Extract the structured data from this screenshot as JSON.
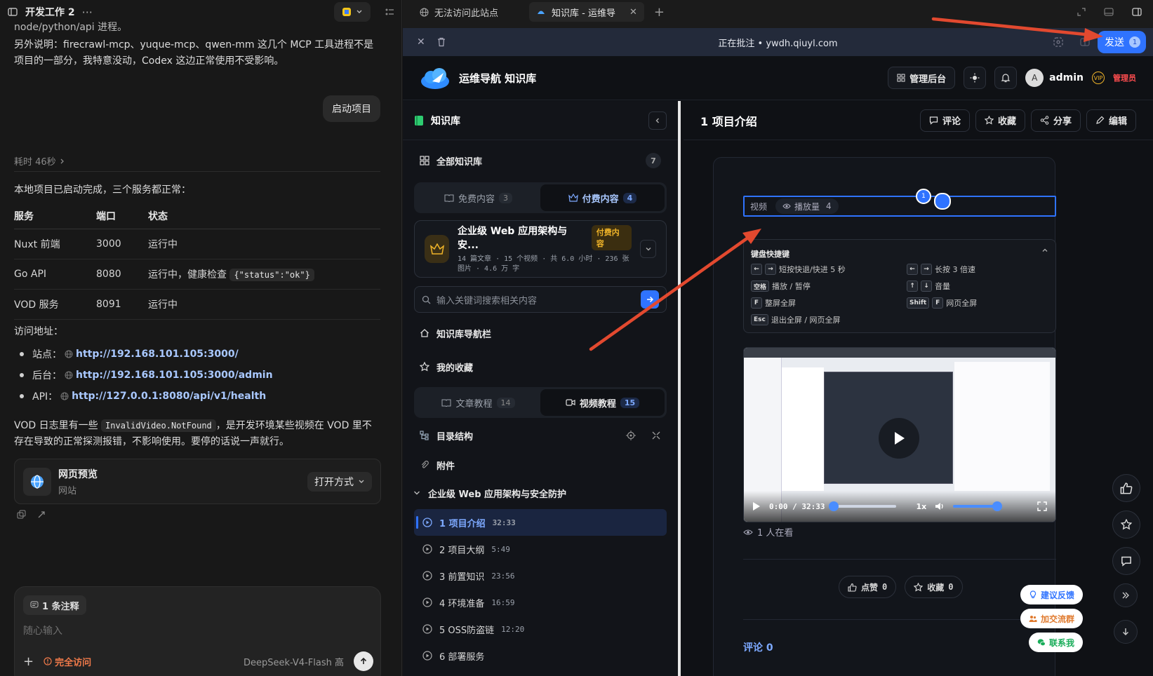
{
  "left": {
    "title": "开发工作 2",
    "msg_top_partial": "node/python/api 进程。",
    "msg_note": "另外说明：firecrawl-mcp、yuque-mcp、qwen-mm 这几个 MCP 工具进程不是项目的一部分，我特意没动，Codex 这边正常使用不受影响。",
    "user_bubble": "启动项目",
    "elapsed": "耗时 46秒",
    "summary": "本地项目已启动完成，三个服务都正常：",
    "table": {
      "headers": [
        "服务",
        "端口",
        "状态"
      ],
      "rows": [
        {
          "svc": "Nuxt 前端",
          "port": "3000",
          "status": "运行中",
          "code": ""
        },
        {
          "svc": "Go API",
          "port": "8080",
          "status": "运行中，健康检查",
          "code": "{\"status\":\"ok\"}"
        },
        {
          "svc": "VOD 服务",
          "port": "8091",
          "status": "运行中",
          "code": ""
        }
      ]
    },
    "access_title": "访问地址：",
    "links": [
      {
        "label": "站点：",
        "url": "http://192.168.101.105:3000/"
      },
      {
        "label": "后台：",
        "url": "http://192.168.101.105:3000/admin"
      },
      {
        "label": "API：",
        "url": "http://127.0.0.1:8080/api/v1/health"
      }
    ],
    "vod_note_a": "VOD 日志里有一些",
    "vod_note_code": "InvalidVideo.NotFound",
    "vod_note_b": "，是开发环境某些视频在 VOD 里不存在导致的正常探测报错，不影响使用。要停的话说一声就行。",
    "preview_card": {
      "title": "网页预览",
      "sub": "网站",
      "open": "打开方式"
    },
    "composer": {
      "annotation": "1 条注释",
      "placeholder": "随心输入",
      "access": "完全访问",
      "model": "DeepSeek-V4-Flash",
      "level": "高"
    }
  },
  "browser": {
    "tabs": [
      {
        "title": "无法访问此站点"
      },
      {
        "title": "知识库 - 运维导"
      }
    ],
    "annotating": "正在批注 • ywdh.qiuyl.com",
    "send": "发送",
    "send_count": "1"
  },
  "site": {
    "brand": "运维导航 知识库",
    "admin_btn": "管理后台",
    "user": "admin",
    "avatar_letter": "A",
    "role": "管理员",
    "sidebar": {
      "title": "知识库",
      "all": "全部知识库",
      "all_count": "7",
      "seg1": [
        {
          "label": "免费内容",
          "n": "3"
        },
        {
          "label": "付费内容",
          "n": "4"
        }
      ],
      "course_title": "企业级 Web 应用架构与安...",
      "course_tag": "付费内容",
      "course_sub": "14 篇文章 · 15 个视频 · 共 6.0 小时 · 236 张图片 · 4.6 万 字",
      "search_ph": "输入关键词搜索相关内容",
      "nav": "知识库导航栏",
      "fav": "我的收藏",
      "seg2": [
        {
          "label": "文章教程",
          "n": "14"
        },
        {
          "label": "视频教程",
          "n": "15"
        }
      ],
      "toc": "目录结构",
      "attach": "附件",
      "group": "企业级 Web 应用架构与安全防护",
      "episodes": [
        {
          "t": "1 项目介绍",
          "d": "32:33"
        },
        {
          "t": "2 项目大纲",
          "d": "5:49"
        },
        {
          "t": "3 前置知识",
          "d": "23:56"
        },
        {
          "t": "4 环境准备",
          "d": "16:59"
        },
        {
          "t": "5 OSS防盗链",
          "d": "12:20"
        },
        {
          "t": "6 部署服务",
          "d": ""
        }
      ]
    },
    "main": {
      "title": "1 项目介绍",
      "actions": [
        "评论",
        "收藏",
        "分享",
        "编辑"
      ],
      "video_tag": "视频",
      "plays": "播放量",
      "plays_n": "4",
      "pin": "1",
      "kbd_title": "键盘快捷键",
      "shortcuts": [
        {
          "keys": [
            "←",
            "→"
          ],
          "desc": "短按快退/快进 5 秒"
        },
        {
          "keys": [
            "←",
            "→"
          ],
          "desc": "长按 3 倍速"
        },
        {
          "keys": [
            "空格"
          ],
          "desc": "播放 / 暂停"
        },
        {
          "keys": [
            "↑",
            "↓"
          ],
          "desc": "音量"
        },
        {
          "keys": [
            "F"
          ],
          "desc": "整屏全屏"
        },
        {
          "keys": [
            "Shift",
            "F"
          ],
          "desc": "网页全屏"
        },
        {
          "keys": [
            "Esc"
          ],
          "desc": "退出全屏 / 网页全屏"
        }
      ],
      "time": "0:00 / 32:33",
      "speed": "1x",
      "watching": "1 人在看",
      "like": "点赞",
      "like_n": "0",
      "collect": "收藏",
      "collect_n": "0",
      "comments": "评论 0",
      "feedback": "建议反馈",
      "group_join": "加交流群",
      "contact": "联系我"
    }
  },
  "colors": {
    "accent": "#2f73ff",
    "arrow": "#e2492f",
    "gold": "#f0b429"
  }
}
